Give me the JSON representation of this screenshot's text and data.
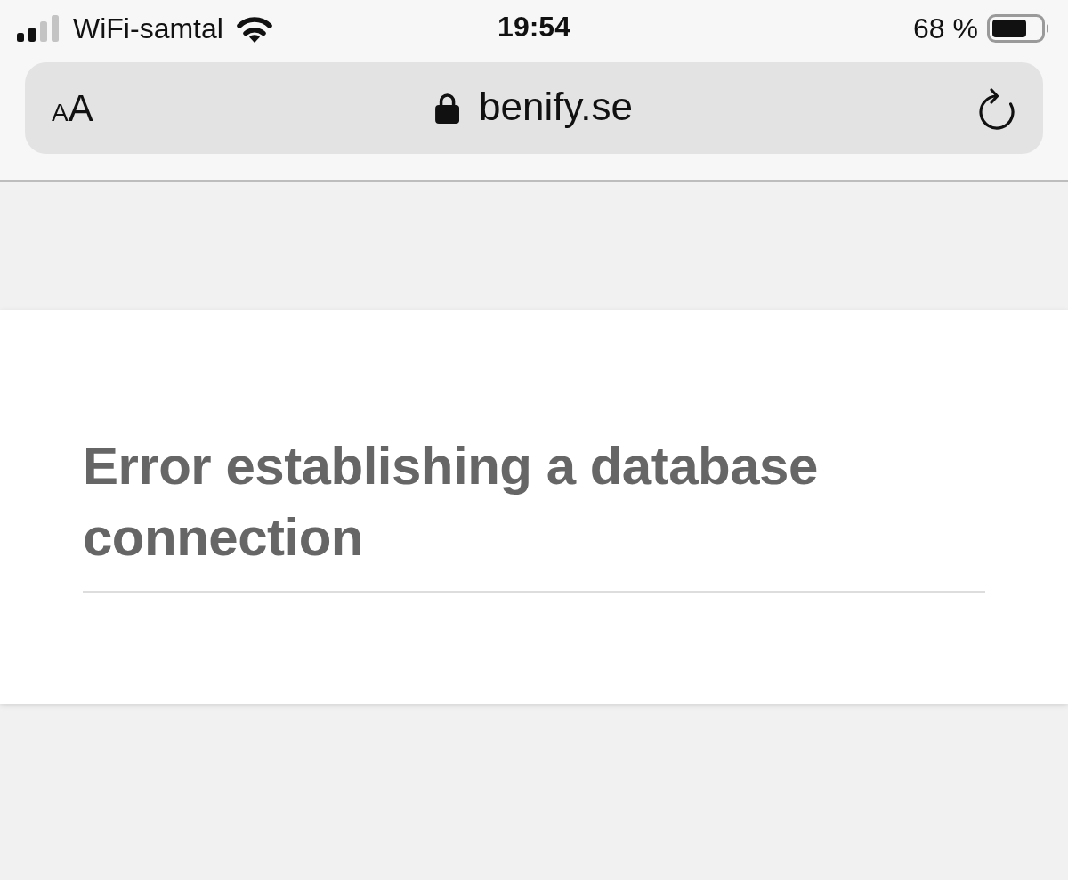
{
  "status_bar": {
    "carrier": "WiFi-samtal",
    "time": "19:54",
    "battery_percent": "68 %"
  },
  "address_bar": {
    "text_size_button": {
      "small_letter": "A",
      "large_letter": "A"
    },
    "url": "benify.se"
  },
  "page": {
    "heading": "Error establishing a database connection"
  }
}
